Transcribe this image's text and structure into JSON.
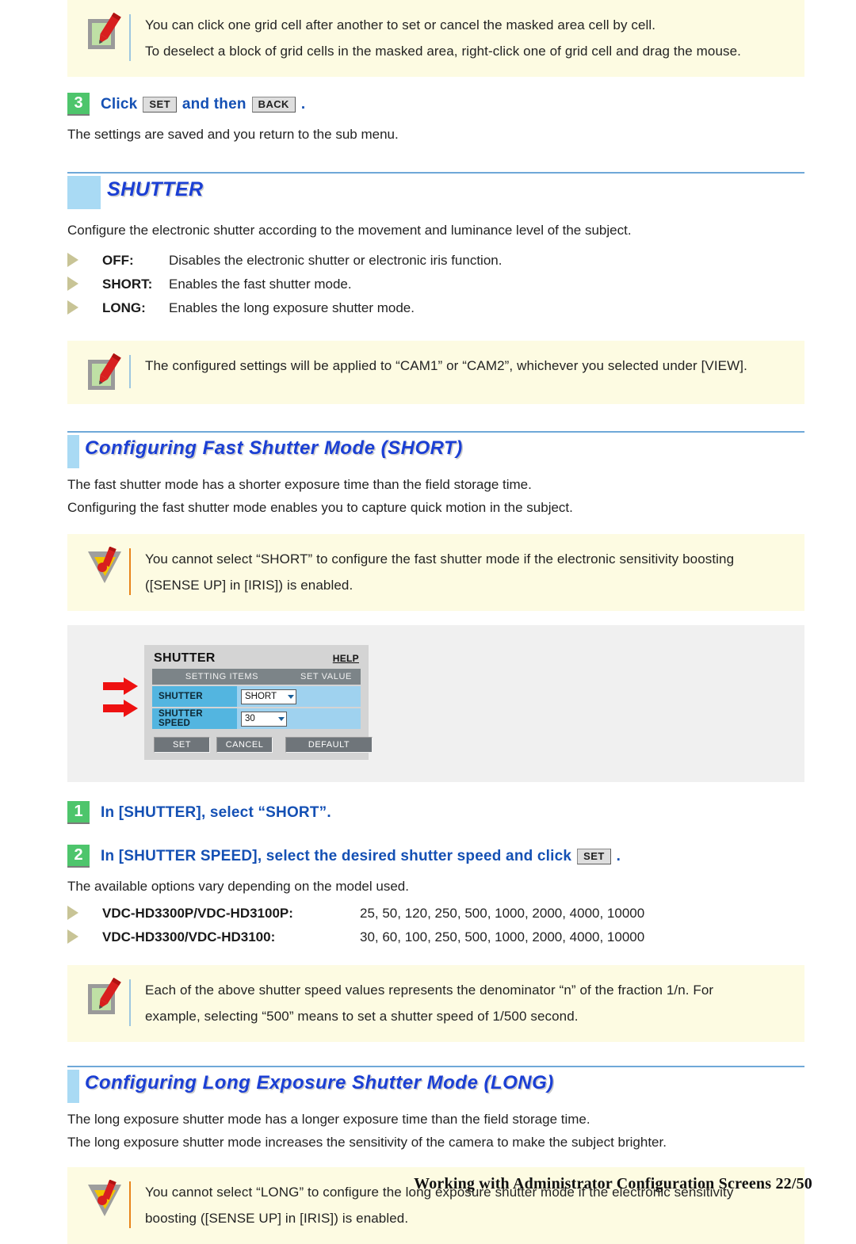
{
  "notes": {
    "note_top": {
      "icon": "note-pencil-icon",
      "lines": [
        "You can click one grid cell after another to set or cancel the masked area cell by cell.",
        "To deselect a block of grid cells in the masked area, right-click one of grid cell and drag the mouse."
      ]
    },
    "note_view": {
      "icon": "note-pencil-icon",
      "lines": [
        "The configured settings will be applied to “CAM1” or “CAM2”, whichever you selected under [VIEW]."
      ]
    },
    "caution_short": {
      "icon": "caution-triangle-icon",
      "lines": [
        "You cannot select “SHORT” to configure the fast shutter mode if the electronic sensitivity boosting",
        "([SENSE UP] in [IRIS]) is enabled."
      ]
    },
    "note_denominator": {
      "icon": "note-pencil-icon",
      "lines": [
        "Each of the above shutter speed values represents the denominator “n” of the fraction 1/n. For",
        "example, selecting “500” means to set a shutter speed of 1/500 second."
      ]
    },
    "caution_long": {
      "icon": "caution-triangle-icon",
      "lines": [
        "You cannot select “LONG” to configure the long exposure shutter mode if the electronic sensitivity",
        "boosting ([SENSE UP] in [IRIS]) is enabled."
      ]
    }
  },
  "step3": {
    "number": "3",
    "text_before": "Click",
    "button_set": "SET",
    "text_middle": "and then",
    "button_back": "BACK",
    "text_after": ".",
    "description": "The settings are saved and you return to the sub menu."
  },
  "shutter_section": {
    "heading": "SHUTTER",
    "intro": "Configure the electronic shutter according to the movement and luminance level of the subject.",
    "options": [
      {
        "term": "OFF:",
        "desc": "Disables the electronic shutter or electronic iris function."
      },
      {
        "term": "SHORT:",
        "desc": "Enables the fast shutter mode."
      },
      {
        "term": "LONG:",
        "desc": "Enables the long exposure shutter mode."
      }
    ]
  },
  "short_section": {
    "heading": "Configuring Fast Shutter Mode (SHORT)",
    "para1": "The fast shutter mode has a shorter exposure time than the field storage time.",
    "para2": "Configuring the fast shutter mode enables you to capture quick motion in the subject."
  },
  "figure": {
    "title": "SHUTTER",
    "help": "HELP",
    "columns": [
      "SETTING ITEMS",
      "SET VALUE"
    ],
    "rows": [
      {
        "label": "SHUTTER",
        "value": "SHORT"
      },
      {
        "label": "SHUTTER SPEED",
        "value": "30"
      }
    ],
    "buttons": [
      "SET",
      "CANCEL",
      "DEFAULT"
    ],
    "colors": {
      "panel_bg": "#d4d4d4",
      "header_bar": "#7c8488",
      "row_bg": "#9fd2ef",
      "row_label_bg": "#53b5e0",
      "button_bg": "#6f757a",
      "arrow": "#ee1111"
    }
  },
  "step1": {
    "number": "1",
    "text": "In [SHUTTER], select “SHORT”."
  },
  "step2": {
    "number": "2",
    "text_before": "In [SHUTTER SPEED], select the desired shutter speed and click",
    "button_set": "SET",
    "text_after": ".",
    "description": "The available options vary depending on the model used.",
    "models": [
      {
        "term": "VDC-HD3300P/VDC-HD3100P:",
        "values": "25, 50, 120, 250, 500, 1000, 2000, 4000, 10000"
      },
      {
        "term": "VDC-HD3300/VDC-HD3100:",
        "values": "30, 60, 100, 250, 500, 1000, 2000, 4000, 10000"
      }
    ]
  },
  "long_section": {
    "heading": "Configuring Long Exposure Shutter Mode (LONG)",
    "para1": "The long exposure shutter mode has a longer exposure time than the field storage time.",
    "para2": "The long exposure shutter mode increases the sensitivity of the camera to make the subject brighter."
  },
  "footer": {
    "text": "Working with Administrator Configuration Screens 22/50"
  },
  "theme": {
    "heading_blue": "#1b3fd4",
    "swatch_blue": "#a9daf4",
    "callout_bg": "#fdfbe2",
    "step_green": "#4ec56c",
    "bullet_khaki": "#c8c496"
  }
}
